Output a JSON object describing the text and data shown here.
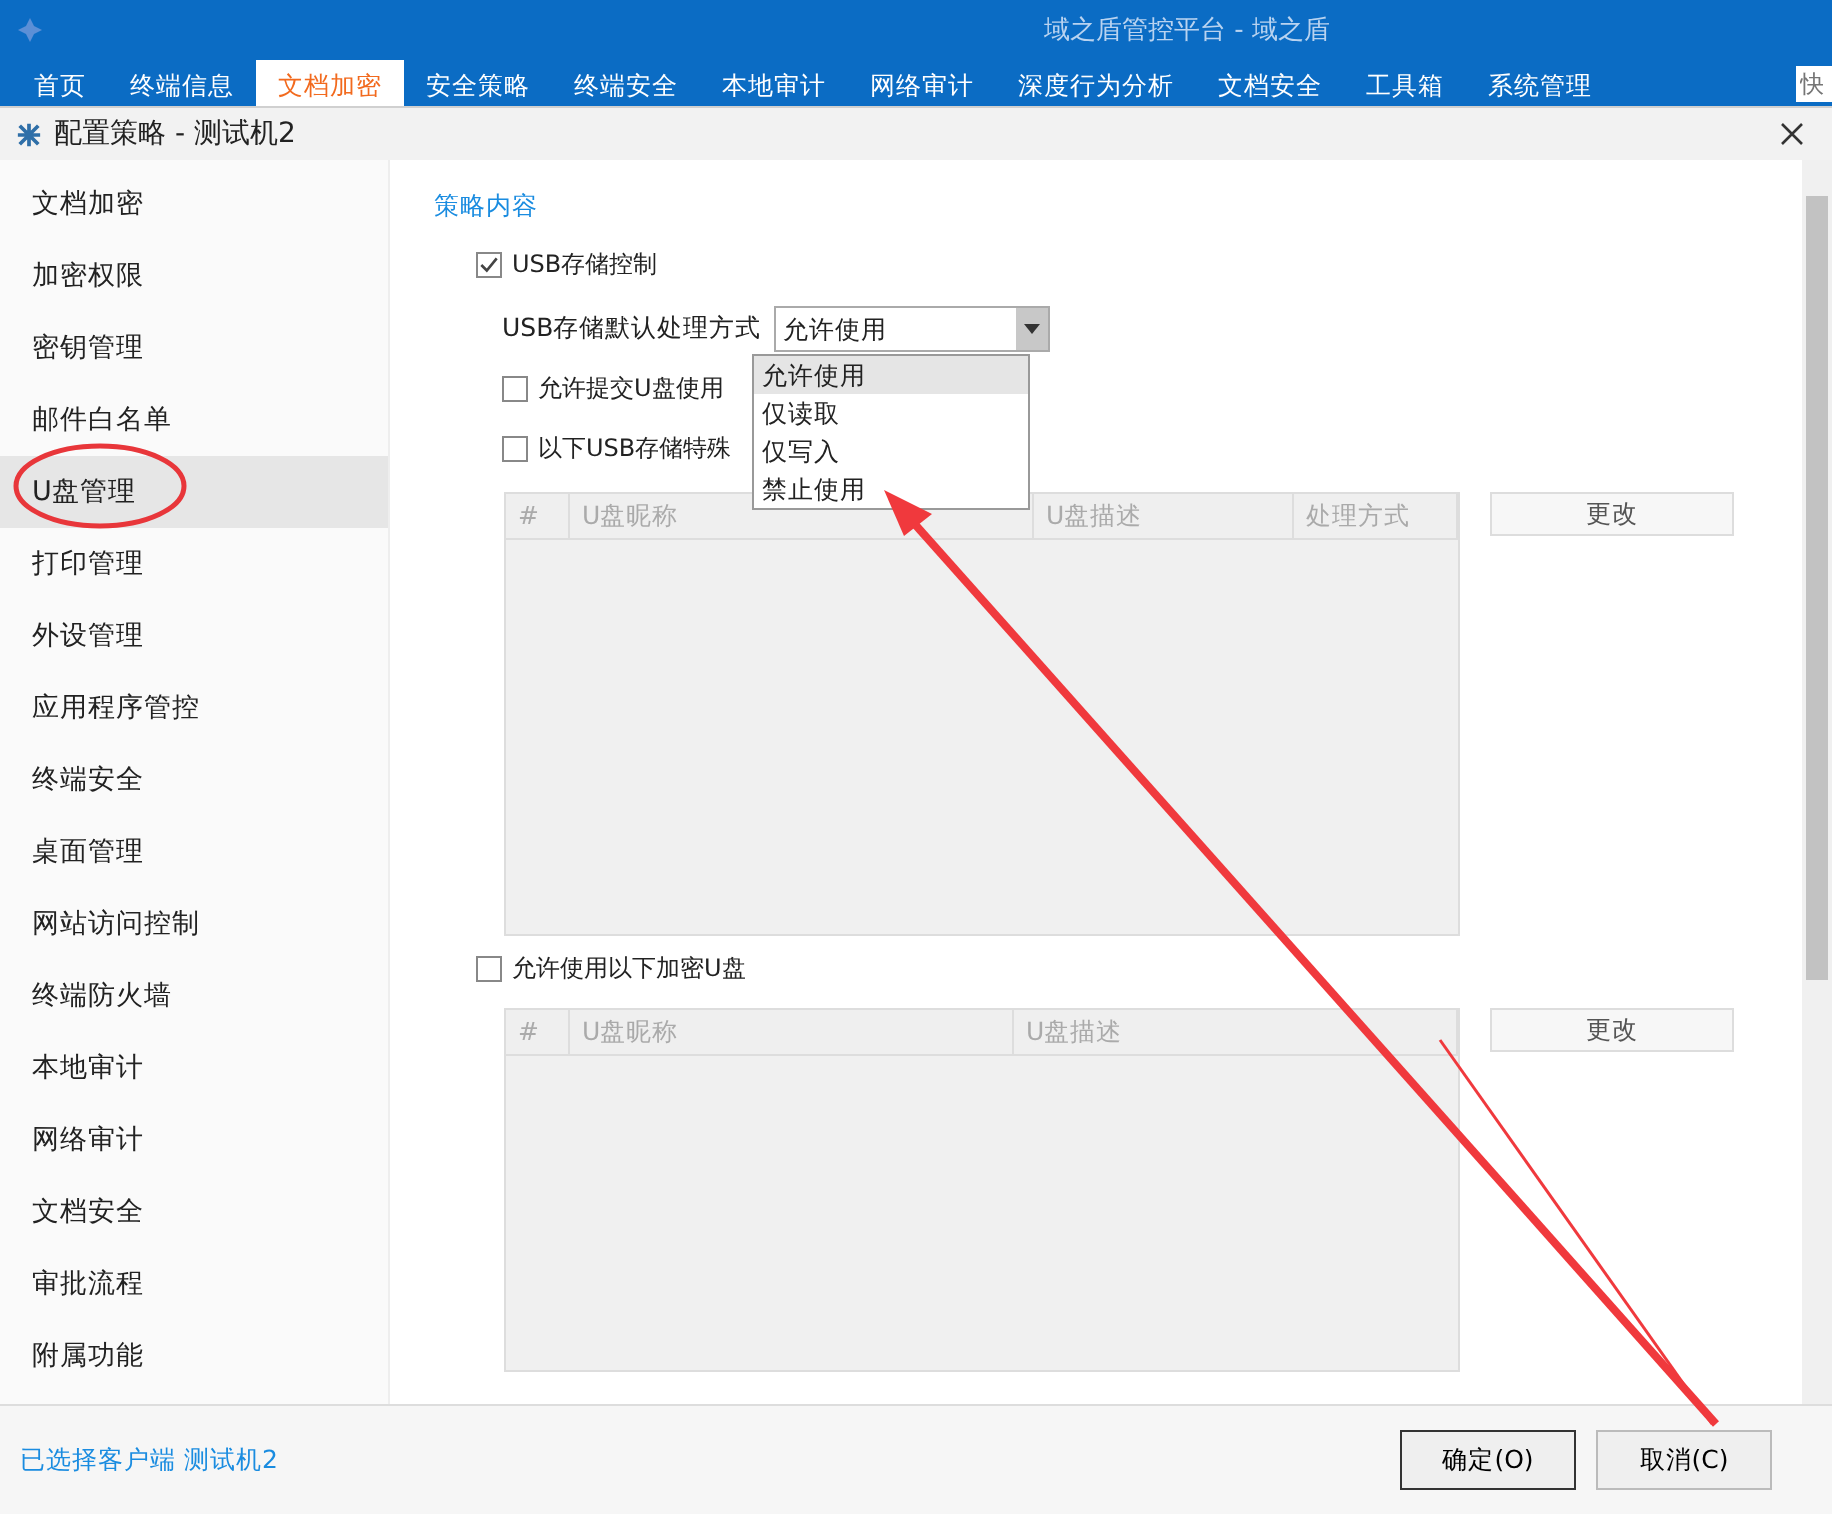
{
  "window": {
    "title": "域之盾管控平台 - 域之盾"
  },
  "nav_tabs": [
    {
      "label": "首页",
      "selected": false
    },
    {
      "label": "终端信息",
      "selected": false
    },
    {
      "label": "文档加密",
      "selected": true
    },
    {
      "label": "安全策略",
      "selected": false
    },
    {
      "label": "终端安全",
      "selected": false
    },
    {
      "label": "本地审计",
      "selected": false
    },
    {
      "label": "网络审计",
      "selected": false
    },
    {
      "label": "深度行为分析",
      "selected": false
    },
    {
      "label": "文档安全",
      "selected": false
    },
    {
      "label": "工具箱",
      "selected": false
    },
    {
      "label": "系统管理",
      "selected": false
    }
  ],
  "search": {
    "placeholder": "快"
  },
  "dialog": {
    "title": "配置策略 - 测试机2"
  },
  "sidebar": {
    "items": [
      {
        "label": "文档加密",
        "selected": false
      },
      {
        "label": "加密权限",
        "selected": false
      },
      {
        "label": "密钥管理",
        "selected": false
      },
      {
        "label": "邮件白名单",
        "selected": false
      },
      {
        "label": "U盘管理",
        "selected": true
      },
      {
        "label": "打印管理",
        "selected": false
      },
      {
        "label": "外设管理",
        "selected": false
      },
      {
        "label": "应用程序管控",
        "selected": false
      },
      {
        "label": "终端安全",
        "selected": false
      },
      {
        "label": "桌面管理",
        "selected": false
      },
      {
        "label": "网站访问控制",
        "selected": false
      },
      {
        "label": "终端防火墙",
        "selected": false
      },
      {
        "label": "本地审计",
        "selected": false
      },
      {
        "label": "网络审计",
        "selected": false
      },
      {
        "label": "文档安全",
        "selected": false
      },
      {
        "label": "审批流程",
        "selected": false
      },
      {
        "label": "附属功能",
        "selected": false
      }
    ]
  },
  "section_title": "策略内容",
  "usb_control": {
    "label": "USB存储控制",
    "checked": true
  },
  "default_mode": {
    "label": "USB存储默认处理方式",
    "value": "允许使用",
    "options": [
      {
        "label": "允许使用",
        "selected": true
      },
      {
        "label": "仅读取",
        "selected": false
      },
      {
        "label": "仅写入",
        "selected": false
      },
      {
        "label": "禁止使用",
        "selected": false
      }
    ]
  },
  "options": [
    {
      "label": "允许提交U盘使用",
      "checked": false
    },
    {
      "label": "以下USB存储特殊",
      "checked": false
    }
  ],
  "table1": {
    "columns": [
      "#",
      "U盘昵称",
      "U盘描述",
      "处理方式"
    ],
    "button": "更改"
  },
  "encrypted_usb": {
    "label": "允许使用以下加密U盘",
    "checked": false
  },
  "table2": {
    "columns": [
      "#",
      "U盘昵称",
      "U盘描述"
    ],
    "button": "更改"
  },
  "footer": {
    "status": "已选择客户端 测试机2",
    "buttons": [
      "确定(O)",
      "取消(C)"
    ]
  }
}
